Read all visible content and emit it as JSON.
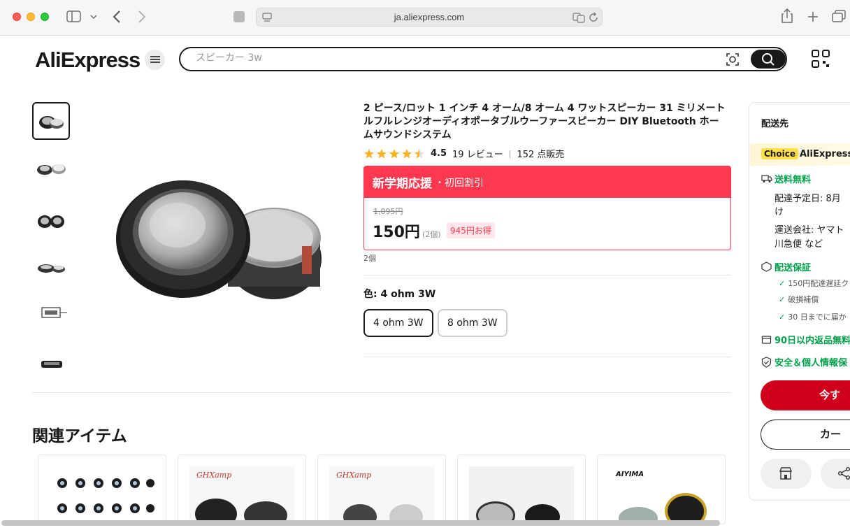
{
  "browser": {
    "url": "ja.aliexpress.com"
  },
  "header": {
    "logo": "AliExpress",
    "search_placeholder": "スピーカー 3w"
  },
  "product": {
    "title": "2 ピース/ロット 1 インチ 4 オーム/8 オーム 4 ワットスピーカー 31 ミリメートルフルレンジオーディオポータブルウーファースピーカー DIY Bluetooth ホームサウンドシステム",
    "rating": "4.5",
    "rating_fraction": 0.9,
    "reviews": "19 レビュー",
    "sold": "152 点販売",
    "promo_main": "新学期応援",
    "promo_sub": "・初回割引",
    "original_price": "1,095円",
    "price": "150円",
    "price_qty": "(2個)",
    "savings": "945円お得",
    "quantity_note": "2個",
    "color_label": "色: 4 ohm 3W",
    "options": [
      "4 ohm 3W",
      "8 ohm 3W"
    ],
    "selected_option": "4 ohm 3W"
  },
  "related": {
    "title": "関連アイテム",
    "brands": [
      "",
      "GHXamp",
      "GHXamp",
      "",
      "AIYIMA"
    ]
  },
  "shipping_panel": {
    "title": "配送先",
    "choice_tag": "Choice",
    "choice_brand": "AliExpress",
    "free_shipping": "送料無料",
    "delivery_label": "配達予定日: 8月",
    "delivery_cont": "け",
    "carrier_label": "運送会社: ヤマト",
    "carrier_cont": "川急便 など",
    "guarantee": "配送保証",
    "guarantee_items": [
      "150円配達遅延ク",
      "破損補償",
      "30 日までに届か"
    ],
    "returns": "90日以内返品無料",
    "security": "安全＆個人情報保",
    "buy_now": "今す",
    "cart": "カー"
  },
  "colors": {
    "brand_red": "#fd384f",
    "buy_red": "#d0021b",
    "green": "#00a04a",
    "star": "#fdb022"
  }
}
